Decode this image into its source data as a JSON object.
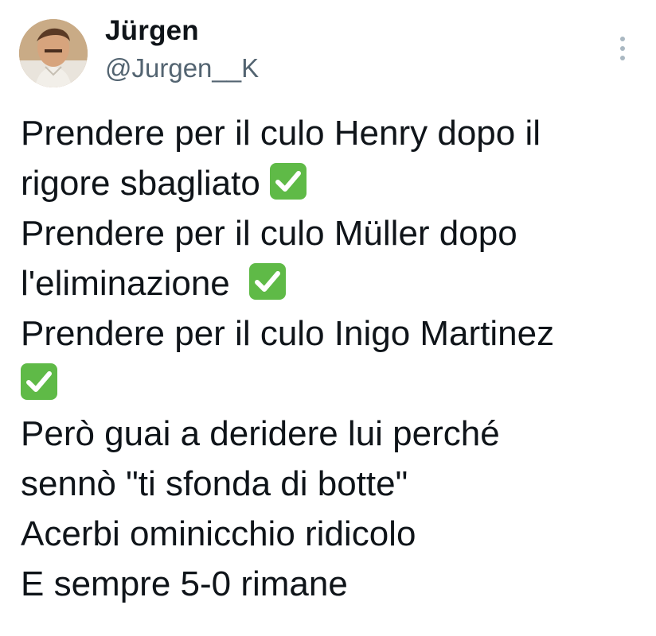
{
  "user": {
    "name": "Jürgen",
    "handle": "@Jurgen__K",
    "avatar_icon": "profile-photo"
  },
  "menu_icon": "more-vertical-icon",
  "tweet": {
    "lines": [
      "Prendere per il culo Henry dopo il",
      "rigore sbagliato ",
      "Prendere per il culo Müller dopo",
      "l'eliminazione  ",
      "Prendere per il culo Inigo Martinez",
      "",
      "Però guai a deridere lui perché",
      "sennò \"ti sfonda di botte\"",
      "Acerbi ominicchio ridicolo",
      "E sempre 5-0 rimane"
    ],
    "emoji": "check-mark-button-icon",
    "emoji_color": "#5fba47"
  }
}
